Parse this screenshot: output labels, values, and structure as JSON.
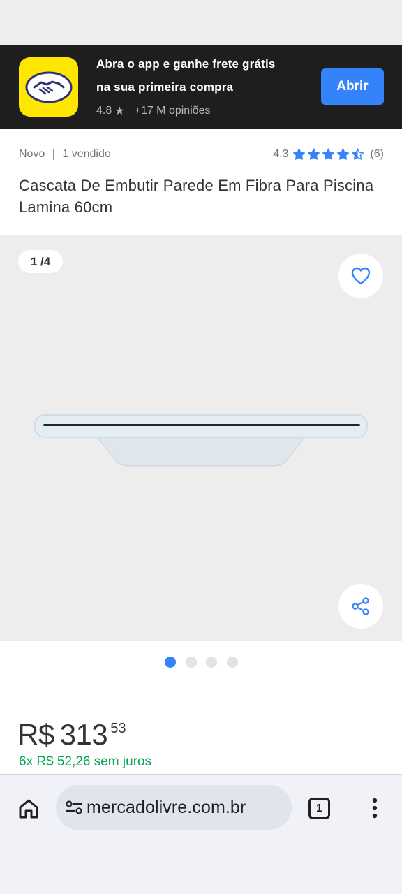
{
  "app_banner": {
    "line1": "Abra o app e ganhe frete grátis",
    "line2": "na sua primeira compra",
    "rating": "4.8",
    "reviews": "+17 M opiniões",
    "open_label": "Abrir",
    "logo_color": "#ffe600",
    "background_color": "#1e1e1e"
  },
  "product": {
    "condition": "Novo",
    "sold": "1 vendido",
    "rating": "4.3",
    "rating_value": 4.3,
    "rating_max": 5,
    "reviews_count": "(6)",
    "title": "Cascata De Embutir Parede Em Fibra Para Piscina Lamina 60cm"
  },
  "gallery": {
    "counter": "1 /4",
    "current_index": 1,
    "total": 4,
    "favorite_icon": "heart-icon",
    "share_icon": "share-icon"
  },
  "price": {
    "currency": "R$",
    "integer": "313",
    "cents": "53",
    "installments": "6x R$ 52,26 sem juros"
  },
  "browser": {
    "url": "mercadolivre.com.br",
    "tab_count": "1",
    "home_icon": "home-icon",
    "site_settings_icon": "tune-icon",
    "menu_icon": "more-vert-icon"
  },
  "colors": {
    "accent": "#3483fa",
    "installments": "#00a650",
    "star": "#3483fa"
  }
}
